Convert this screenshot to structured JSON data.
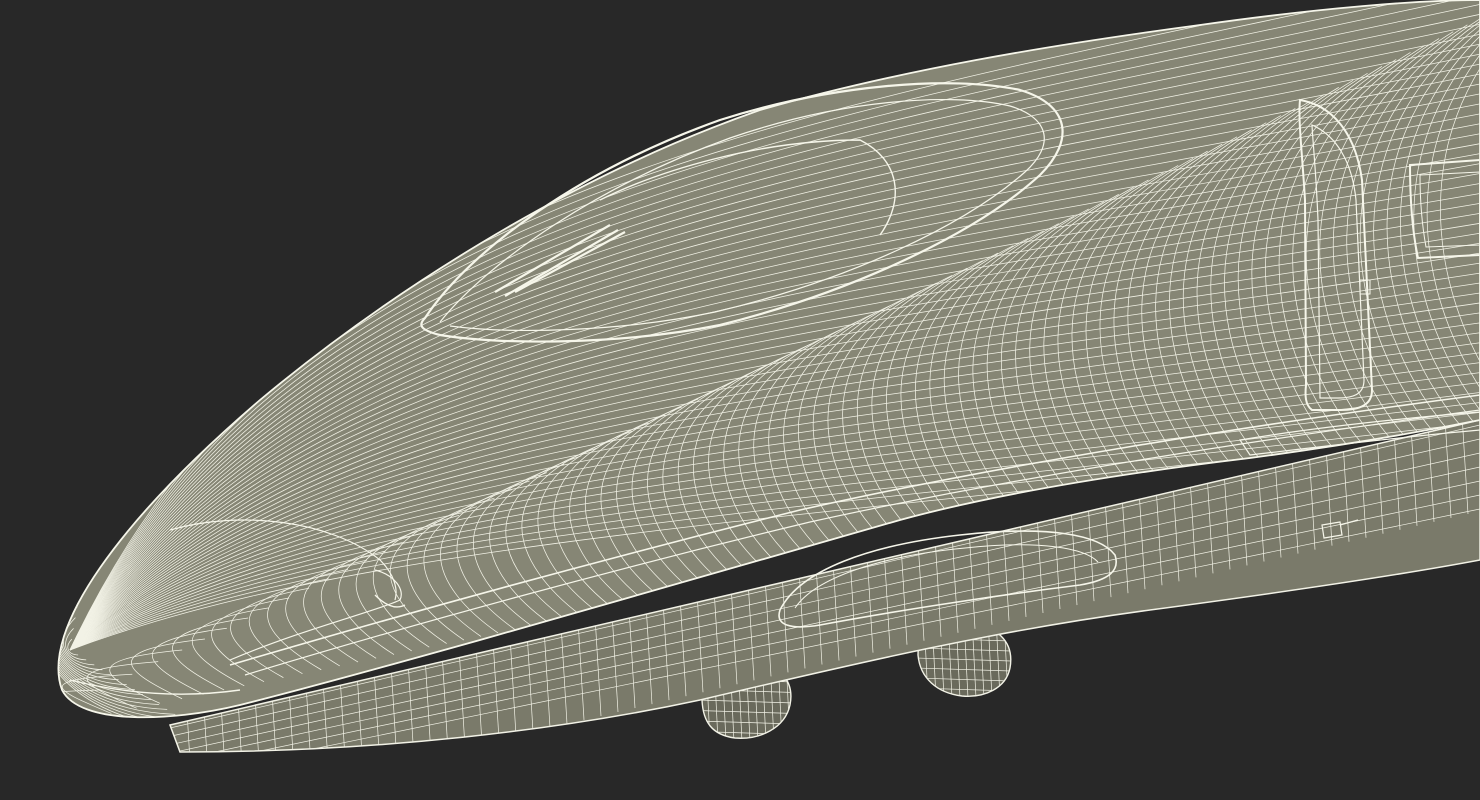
{
  "scene": {
    "background_color": "#282828",
    "body_fill_color": "#868675",
    "body_shade_color": "#6f6f60",
    "wire_color": "#f2f2e6",
    "wire_dim_color": "#d8d8c8",
    "subject_icon": "train-wireframe-icon"
  }
}
